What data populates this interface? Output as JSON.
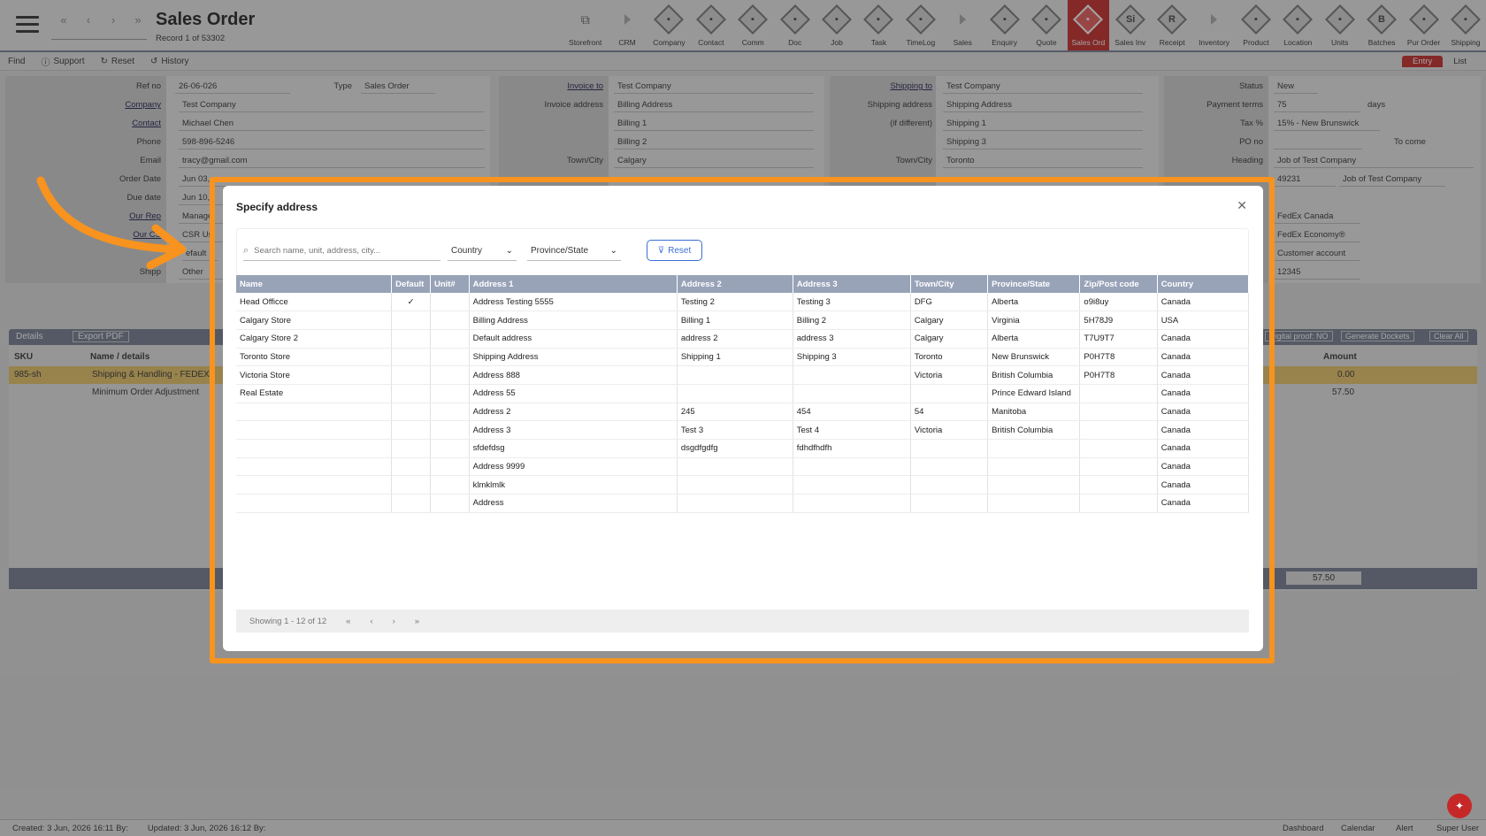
{
  "header": {
    "title": "Sales Order",
    "record": "Record 1 of 53302"
  },
  "nav_arrows": [
    "«",
    "‹",
    "›",
    "»"
  ],
  "modules": [
    {
      "label": "Storefront",
      "icon": "external-link-icon"
    },
    {
      "label": "CRM",
      "icon": "arrow-icon"
    },
    {
      "label": "Company",
      "icon": "company-icon"
    },
    {
      "label": "Contact",
      "icon": "contact-icon"
    },
    {
      "label": "Comm",
      "icon": "comm-icon"
    },
    {
      "label": "Doc",
      "icon": "doc-icon"
    },
    {
      "label": "Job",
      "icon": "job-icon"
    },
    {
      "label": "Task",
      "icon": "task-icon"
    },
    {
      "label": "TimeLog",
      "icon": "clock-icon"
    },
    {
      "label": "Sales",
      "icon": "arrow-icon"
    },
    {
      "label": "Enquiry",
      "icon": "enquiry-icon"
    },
    {
      "label": "Quote",
      "icon": "quote-icon"
    },
    {
      "label": "Sales Ord",
      "icon": "sales-order-icon"
    },
    {
      "label": "Sales Inv",
      "icon": "sales-invoice-icon",
      "letter": "Si"
    },
    {
      "label": "Receipt",
      "icon": "receipt-icon",
      "letter": "R"
    },
    {
      "label": "Inventory",
      "icon": "arrow-icon"
    },
    {
      "label": "Product",
      "icon": "product-icon"
    },
    {
      "label": "Location",
      "icon": "location-icon"
    },
    {
      "label": "Units",
      "icon": "units-icon"
    },
    {
      "label": "Batches",
      "icon": "batches-icon",
      "letter": "B"
    },
    {
      "label": "Pur Order",
      "icon": "purchase-order-icon"
    },
    {
      "label": "Shipping",
      "icon": "shipping-icon"
    }
  ],
  "toolbar": {
    "find": "Find",
    "support": "Support",
    "reset": "Reset",
    "history": "History",
    "entry": "Entry",
    "list": "List"
  },
  "form": {
    "ref_label": "Ref no",
    "ref": "26-06-026",
    "type_label": "Type",
    "type": "Sales Order",
    "company_label": "Company",
    "company": "Test Company",
    "contact_label": "Contact",
    "contact": "Michael Chen",
    "phone_label": "Phone",
    "phone": "598-896-5246",
    "email_label": "Email",
    "email": "tracy@gmail.com",
    "order_date_label": "Order Date",
    "order_date": "Jun 03,",
    "due_date_label": "Due date",
    "due_date": "Jun 10,",
    "our_rep_label": "Our Rep",
    "our_rep": "Manage",
    "our_csr_label": "Our CS",
    "our_csr": "CSR Us",
    "default_val": "efault",
    "ship_label": "Shipp",
    "ship": "Other",
    "invoice_to_label": "Invoice to",
    "invoice_to": "Test Company",
    "invoice_address_label": "Invoice address",
    "invoice_address": "Billing Address",
    "billing1": "Billing 1",
    "billing2": "Billing 2",
    "town_label": "Town/City",
    "inv_town": "Calgary",
    "shipping_to_label": "Shipping to",
    "shipping_to": "Test Company",
    "shipping_address_label": "Shipping address",
    "shipping_address": "Shipping Address",
    "if_different": "(if different)",
    "shipping1": "Shipping 1",
    "shipping3": "Shipping 3",
    "ship_town": "Toronto",
    "status_label": "Status",
    "status": "New",
    "payment_label": "Payment terms",
    "payment": "75",
    "days": "days",
    "tax_label": "Tax %",
    "tax": "15% - New Brunswick",
    "po_label": "PO no",
    "to_come": "To come",
    "heading_label": "Heading",
    "heading": "Job of Test Company",
    "job_no": "49231",
    "job_name": "Job of Test Company",
    "carrier": "FedEx Canada",
    "service": "FedEx Economy®",
    "account": "Customer account",
    "acct_no": "12345"
  },
  "details": {
    "label": "Details",
    "export": "Export PDF",
    "digital": "Digital proof: NO",
    "dockets": "Generate Dockets",
    "clear": "Clear All",
    "col_sku": "SKU",
    "col_name": "Name / details",
    "col_amount": "Amount",
    "rows": [
      {
        "sku": "985-sh",
        "name": "Shipping & Handling - FEDEX",
        "amount": "0.00"
      },
      {
        "sku": "",
        "name": "Minimum Order Adjustment",
        "amount": "57.50"
      }
    ],
    "total": "57.50"
  },
  "footer": {
    "created": "Created: 3 Jun, 2026  16:11  By:",
    "updated": "Updated: 3 Jun, 2026  16:12  By:",
    "links": [
      "Dashboard",
      "Calendar",
      "Alert",
      "Super User"
    ]
  },
  "modal": {
    "title": "Specify address",
    "search_placeholder": "Search name, unit, address, city...",
    "country_filter": "Country",
    "province_filter": "Province/State",
    "reset": "Reset",
    "columns": [
      "Name",
      "Default",
      "Unit#",
      "Address 1",
      "Address 2",
      "Address 3",
      "Town/City",
      "Province/State",
      "Zip/Post code",
      "Country"
    ],
    "rows": [
      [
        "Head Officce",
        "✓",
        "",
        "Address Testing 5555",
        "Testing 2",
        "Testing 3",
        "DFG",
        "Alberta",
        "o9i8uy",
        "Canada"
      ],
      [
        "Calgary Store",
        "",
        "",
        "Billing Address",
        "Billing 1",
        "Billing 2",
        "Calgary",
        "Virginia",
        "5H78J9",
        "USA"
      ],
      [
        "Calgary Store 2",
        "",
        "",
        "Default address",
        "address 2",
        "address 3",
        "Calgary",
        "Alberta",
        "T7U9T7",
        "Canada"
      ],
      [
        "Toronto Store",
        "",
        "",
        "Shipping Address",
        "Shipping 1",
        "Shipping 3",
        "Toronto",
        "New Brunswick",
        "P0H7T8",
        "Canada"
      ],
      [
        "Victoria Store",
        "",
        "",
        "Address 888",
        "",
        "",
        "Victoria",
        "British Columbia",
        "P0H7T8",
        "Canada"
      ],
      [
        "Real Estate",
        "",
        "",
        "Address 55",
        "",
        "",
        "",
        "Prince Edward Island",
        "",
        "Canada"
      ],
      [
        "",
        "",
        "",
        "Address 2",
        "245",
        "454",
        "54",
        "Manitoba",
        "",
        "Canada"
      ],
      [
        "",
        "",
        "",
        "Address 3",
        "Test 3",
        "Test 4",
        "Victoria",
        "British Columbia",
        "",
        "Canada"
      ],
      [
        "",
        "",
        "",
        "sfdefdsg",
        "dsgdfgdfg",
        "fdhdfhdfh",
        "",
        "",
        "",
        "Canada"
      ],
      [
        "",
        "",
        "",
        "Address 9999",
        "",
        "",
        "",
        "",
        "",
        "Canada"
      ],
      [
        "",
        "",
        "",
        "klmklmlk",
        "",
        "",
        "",
        "",
        "",
        "Canada"
      ],
      [
        "",
        "",
        "",
        "Address",
        "",
        "",
        "",
        "",
        "",
        "Canada"
      ]
    ],
    "pager_text": "Showing 1 - 12 of 12",
    "pager_buttons": [
      "«",
      "‹",
      "›",
      "»"
    ]
  },
  "colors": {
    "accent": "#c62828",
    "highlight": "#f7931e",
    "table_header": "#98a3b8",
    "link": "#3b6fd4"
  }
}
